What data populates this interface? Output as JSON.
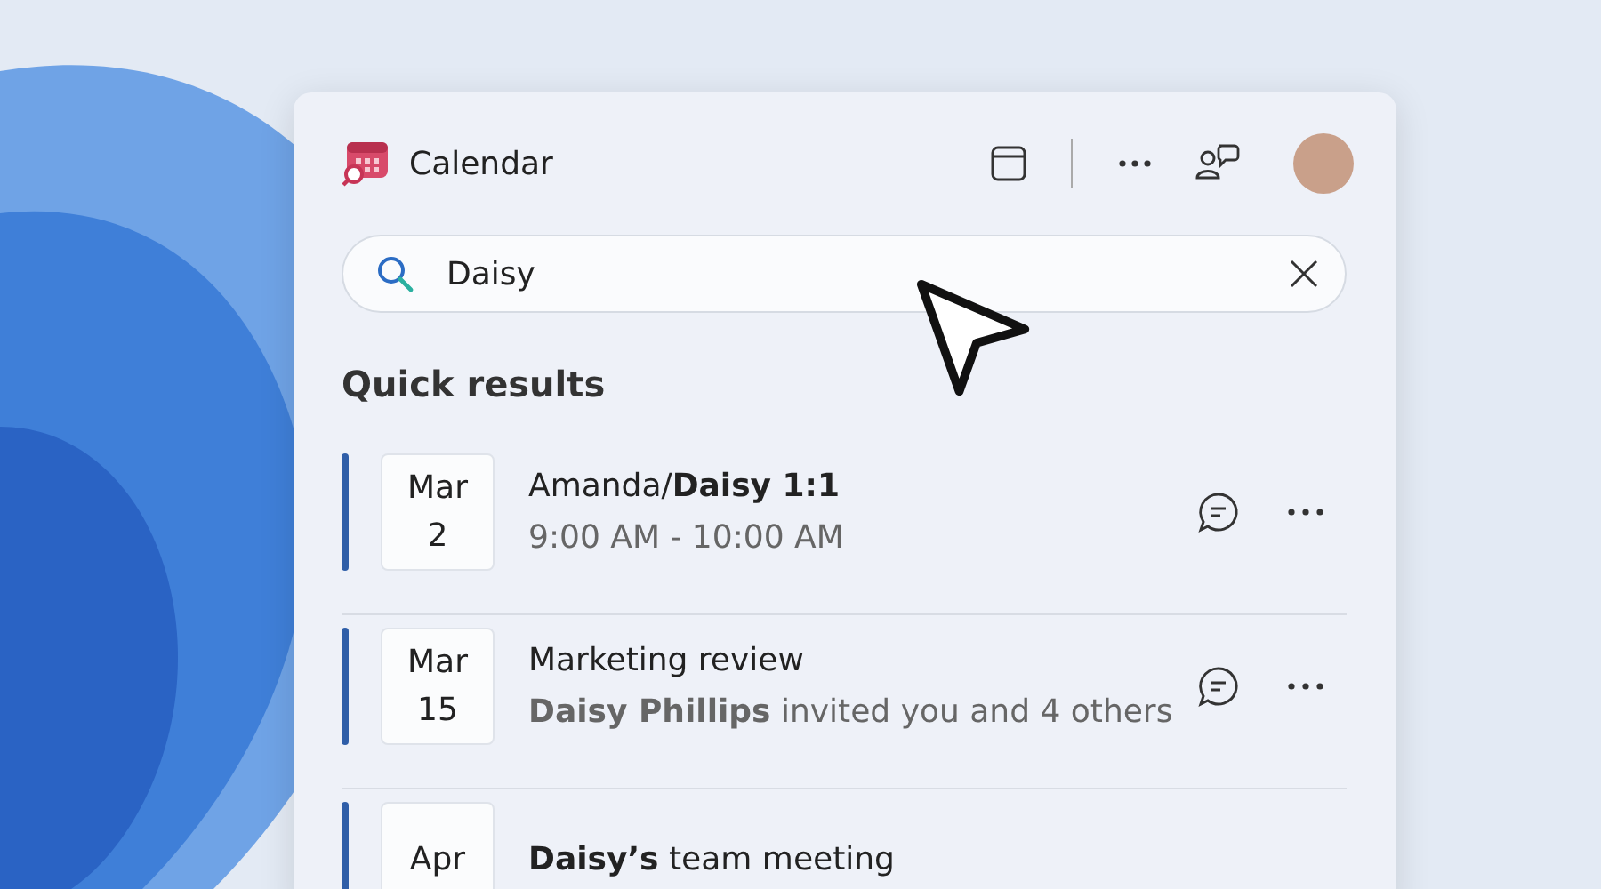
{
  "app": {
    "title": "Calendar"
  },
  "search": {
    "value": "Daisy"
  },
  "section_title": "Quick results",
  "results": [
    {
      "month": "Mar",
      "day": "2",
      "title": "Amanda/**Daisy 1:1**",
      "detail": "9:00 AM - 10:00 AM",
      "color": "#2f5ea8"
    },
    {
      "month": "Mar",
      "day": "15",
      "title": "Marketing review",
      "detail": "**Daisy Phillips** invited you and 4 others",
      "color": "#2f5ea8"
    },
    {
      "month": "Apr",
      "title": "**Daisy’s** team meeting",
      "color": "#2f5ea8"
    }
  ]
}
